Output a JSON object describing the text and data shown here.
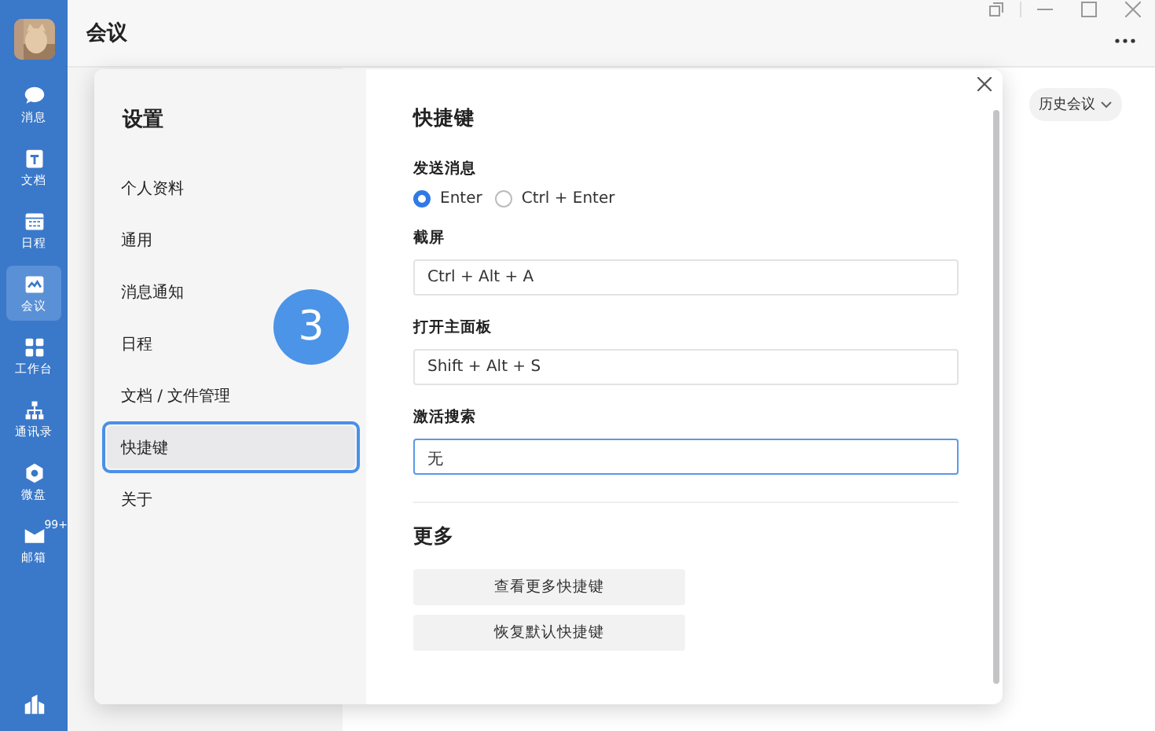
{
  "app": {
    "title": "会议",
    "history_button": "历史会议"
  },
  "nav": [
    {
      "kind": "chat",
      "label": "消息",
      "selected": false
    },
    {
      "kind": "doc",
      "label": "文档",
      "selected": false
    },
    {
      "kind": "calendar",
      "label": "日程",
      "selected": false
    },
    {
      "kind": "meeting",
      "label": "会议",
      "selected": true
    },
    {
      "kind": "apps",
      "label": "工作台",
      "selected": false
    },
    {
      "kind": "org",
      "label": "通讯录",
      "selected": false
    },
    {
      "kind": "drive",
      "label": "微盘",
      "selected": false
    },
    {
      "kind": "mail",
      "label": "邮箱",
      "selected": false,
      "badge": "99+"
    }
  ],
  "settings": {
    "title": "设置",
    "menu": [
      {
        "label": "个人资料",
        "selected": false,
        "highlighted": false
      },
      {
        "label": "通用",
        "selected": false,
        "highlighted": false
      },
      {
        "label": "消息通知",
        "selected": false,
        "highlighted": false
      },
      {
        "label": "日程",
        "selected": false,
        "highlighted": false
      },
      {
        "label": "文档 / 文件管理",
        "selected": false,
        "highlighted": false
      },
      {
        "label": "快捷键",
        "selected": true,
        "highlighted": true
      },
      {
        "label": "关于",
        "selected": false,
        "highlighted": false
      }
    ]
  },
  "shortcuts": {
    "title": "快捷键",
    "sections": [
      {
        "kind": "radio",
        "label": "发送消息",
        "options": [
          {
            "label": "Enter",
            "selected": true
          },
          {
            "label": "Ctrl + Enter",
            "selected": false
          }
        ]
      },
      {
        "kind": "field",
        "label": "截屏",
        "value": "Ctrl + Alt + A",
        "focused": false
      },
      {
        "kind": "field",
        "label": "打开主面板",
        "value": "Shift + Alt + S",
        "focused": false
      },
      {
        "kind": "field",
        "label": "激活搜索",
        "value": "无",
        "focused": true
      }
    ]
  },
  "more": {
    "title": "更多",
    "buttons": [
      "查看更多快捷键",
      "恢复默认快捷键"
    ]
  },
  "annotation": {
    "number": "3"
  }
}
